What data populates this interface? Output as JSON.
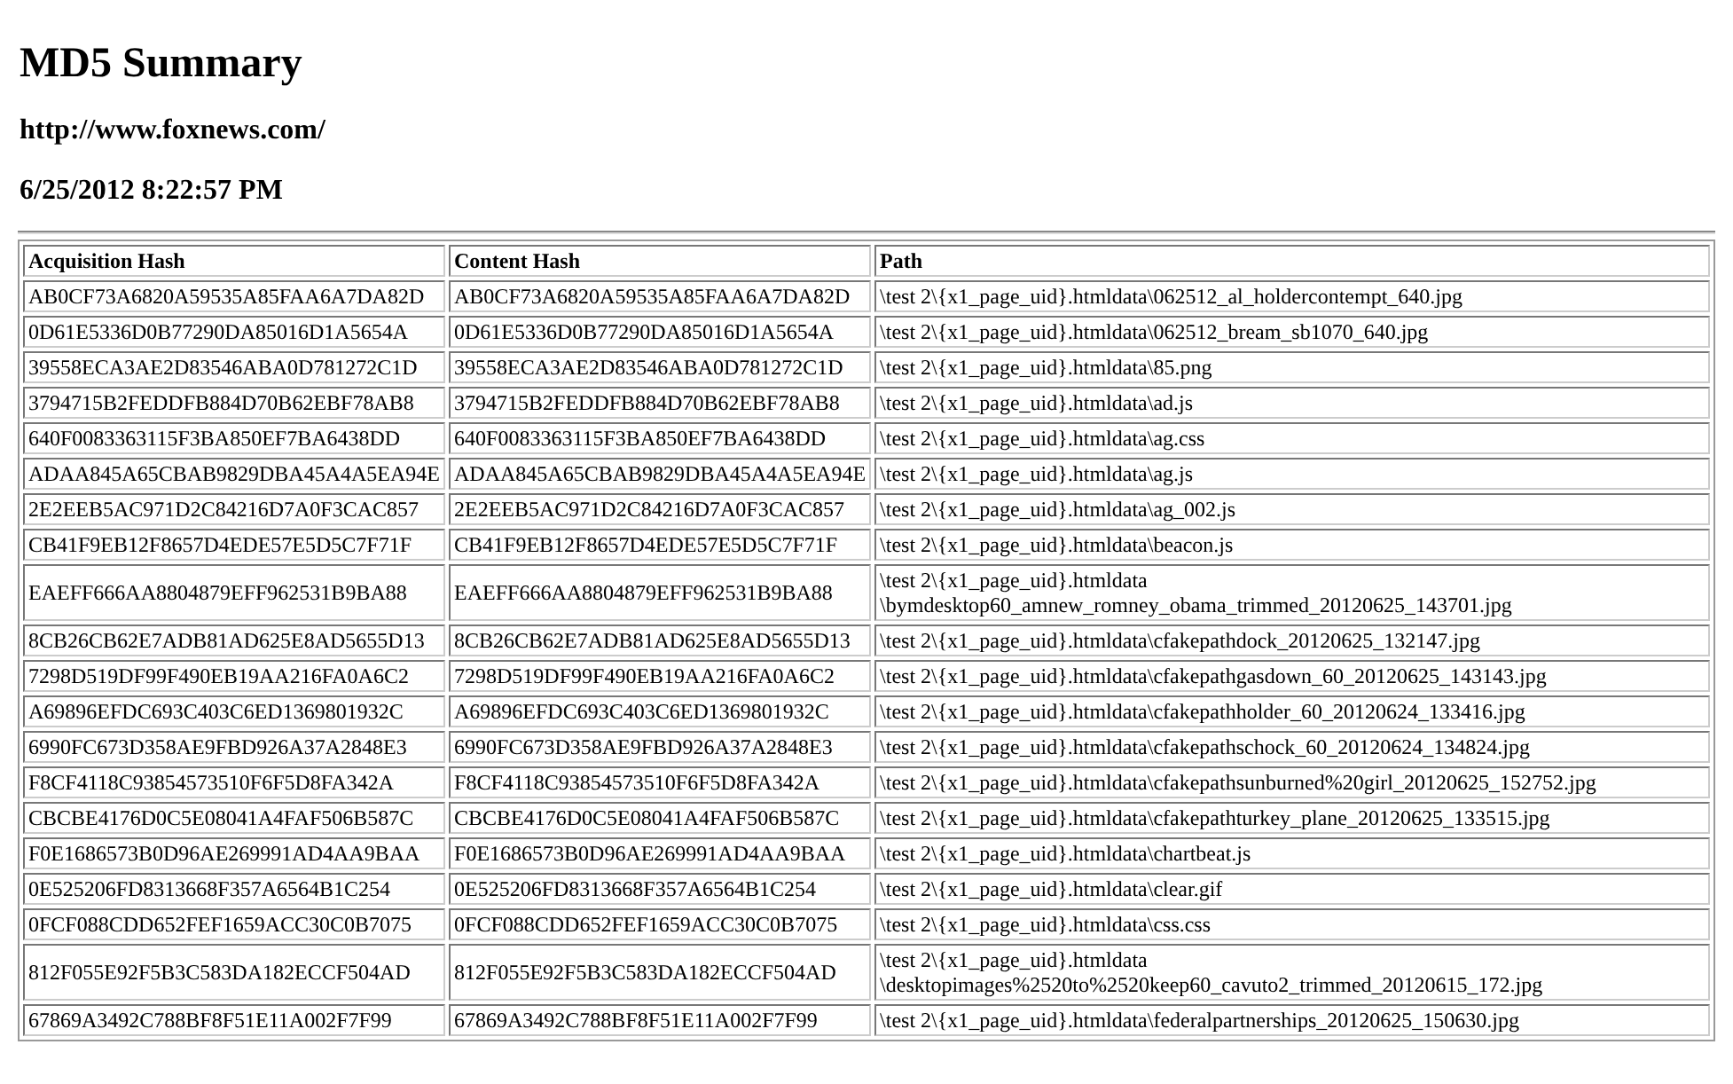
{
  "title": "MD5 Summary",
  "url": "http://www.foxnews.com/",
  "date": "6/25/2012 8:22:57 PM",
  "table": {
    "columns": [
      "Acquisition Hash",
      "Content Hash",
      "Path"
    ],
    "rows": [
      {
        "acquisition_hash": "AB0CF73A6820A59535A85FAA6A7DA82D",
        "content_hash": "AB0CF73A6820A59535A85FAA6A7DA82D",
        "path": [
          "\\test 2\\{x1_page_uid}.htmldata\\062512_al_holdercontempt_640.jpg"
        ]
      },
      {
        "acquisition_hash": "0D61E5336D0B77290DA85016D1A5654A",
        "content_hash": "0D61E5336D0B77290DA85016D1A5654A",
        "path": [
          "\\test 2\\{x1_page_uid}.htmldata\\062512_bream_sb1070_640.jpg"
        ]
      },
      {
        "acquisition_hash": "39558ECA3AE2D83546ABA0D781272C1D",
        "content_hash": "39558ECA3AE2D83546ABA0D781272C1D",
        "path": [
          "\\test 2\\{x1_page_uid}.htmldata\\85.png"
        ]
      },
      {
        "acquisition_hash": "3794715B2FEDDFB884D70B62EBF78AB8",
        "content_hash": "3794715B2FEDDFB884D70B62EBF78AB8",
        "path": [
          "\\test 2\\{x1_page_uid}.htmldata\\ad.js"
        ]
      },
      {
        "acquisition_hash": "640F0083363115F3BA850EF7BA6438DD",
        "content_hash": "640F0083363115F3BA850EF7BA6438DD",
        "path": [
          "\\test 2\\{x1_page_uid}.htmldata\\ag.css"
        ]
      },
      {
        "acquisition_hash": "ADAA845A65CBAB9829DBA45A4A5EA94E",
        "content_hash": "ADAA845A65CBAB9829DBA45A4A5EA94E",
        "path": [
          "\\test 2\\{x1_page_uid}.htmldata\\ag.js"
        ]
      },
      {
        "acquisition_hash": "2E2EEB5AC971D2C84216D7A0F3CAC857",
        "content_hash": "2E2EEB5AC971D2C84216D7A0F3CAC857",
        "path": [
          "\\test 2\\{x1_page_uid}.htmldata\\ag_002.js"
        ]
      },
      {
        "acquisition_hash": "CB41F9EB12F8657D4EDE57E5D5C7F71F",
        "content_hash": "CB41F9EB12F8657D4EDE57E5D5C7F71F",
        "path": [
          "\\test 2\\{x1_page_uid}.htmldata\\beacon.js"
        ]
      },
      {
        "acquisition_hash": "EAEFF666AA8804879EFF962531B9BA88",
        "content_hash": "EAEFF666AA8804879EFF962531B9BA88",
        "path": [
          "\\test 2\\{x1_page_uid}.htmldata",
          "\\bymdesktop60_amnew_romney_obama_trimmed_20120625_143701.jpg"
        ]
      },
      {
        "acquisition_hash": "8CB26CB62E7ADB81AD625E8AD5655D13",
        "content_hash": "8CB26CB62E7ADB81AD625E8AD5655D13",
        "path": [
          "\\test 2\\{x1_page_uid}.htmldata\\cfakepathdock_20120625_132147.jpg"
        ]
      },
      {
        "acquisition_hash": "7298D519DF99F490EB19AA216FA0A6C2",
        "content_hash": "7298D519DF99F490EB19AA216FA0A6C2",
        "path": [
          "\\test 2\\{x1_page_uid}.htmldata\\cfakepathgasdown_60_20120625_143143.jpg"
        ]
      },
      {
        "acquisition_hash": "A69896EFDC693C403C6ED1369801932C",
        "content_hash": "A69896EFDC693C403C6ED1369801932C",
        "path": [
          "\\test 2\\{x1_page_uid}.htmldata\\cfakepathholder_60_20120624_133416.jpg"
        ]
      },
      {
        "acquisition_hash": "6990FC673D358AE9FBD926A37A2848E3",
        "content_hash": "6990FC673D358AE9FBD926A37A2848E3",
        "path": [
          "\\test 2\\{x1_page_uid}.htmldata\\cfakepathschock_60_20120624_134824.jpg"
        ]
      },
      {
        "acquisition_hash": "F8CF4118C93854573510F6F5D8FA342A",
        "content_hash": "F8CF4118C93854573510F6F5D8FA342A",
        "path": [
          "\\test 2\\{x1_page_uid}.htmldata\\cfakepathsunburned%20girl_20120625_152752.jpg"
        ]
      },
      {
        "acquisition_hash": "CBCBE4176D0C5E08041A4FAF506B587C",
        "content_hash": "CBCBE4176D0C5E08041A4FAF506B587C",
        "path": [
          "\\test 2\\{x1_page_uid}.htmldata\\cfakepathturkey_plane_20120625_133515.jpg"
        ]
      },
      {
        "acquisition_hash": "F0E1686573B0D96AE269991AD4AA9BAA",
        "content_hash": "F0E1686573B0D96AE269991AD4AA9BAA",
        "path": [
          "\\test 2\\{x1_page_uid}.htmldata\\chartbeat.js"
        ]
      },
      {
        "acquisition_hash": "0E525206FD8313668F357A6564B1C254",
        "content_hash": "0E525206FD8313668F357A6564B1C254",
        "path": [
          "\\test 2\\{x1_page_uid}.htmldata\\clear.gif"
        ]
      },
      {
        "acquisition_hash": "0FCF088CDD652FEF1659ACC30C0B7075",
        "content_hash": "0FCF088CDD652FEF1659ACC30C0B7075",
        "path": [
          "\\test 2\\{x1_page_uid}.htmldata\\css.css"
        ]
      },
      {
        "acquisition_hash": "812F055E92F5B3C583DA182ECCF504AD",
        "content_hash": "812F055E92F5B3C583DA182ECCF504AD",
        "path": [
          "\\test 2\\{x1_page_uid}.htmldata",
          "\\desktopimages%2520to%2520keep60_cavuto2_trimmed_20120615_172.jpg"
        ]
      },
      {
        "acquisition_hash": "67869A3492C788BF8F51E11A002F7F99",
        "content_hash": "67869A3492C788BF8F51E11A002F7F99",
        "path": [
          "\\test 2\\{x1_page_uid}.htmldata\\federalpartnerships_20120625_150630.jpg"
        ]
      }
    ]
  }
}
